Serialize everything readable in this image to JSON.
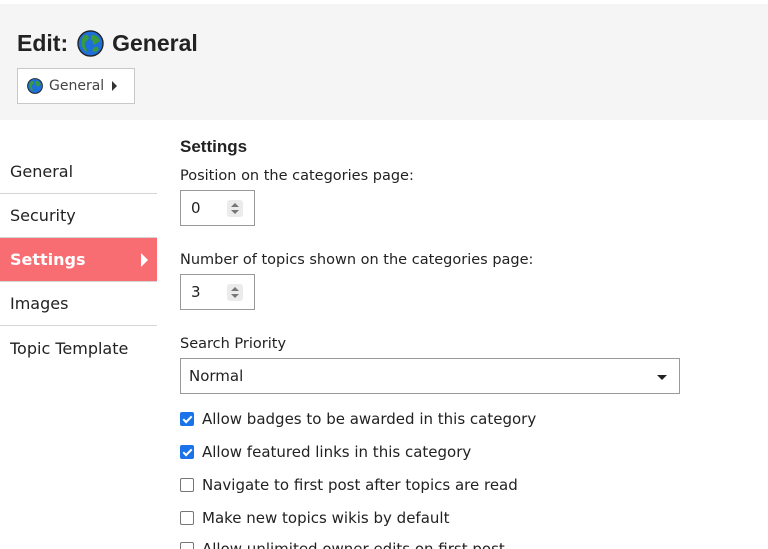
{
  "header": {
    "edit_prefix": "Edit:",
    "category_name": "General",
    "breadcrumb": {
      "label": "General"
    }
  },
  "colors": {
    "header_bg": "#f5f5f5",
    "active_nav_bg": "#f86d72",
    "checkbox_checked": "#1a73e8",
    "globe_ocean": "#1e6fd9",
    "globe_land": "#3a9b3a"
  },
  "nav": {
    "items": [
      {
        "label": "General",
        "active": false
      },
      {
        "label": "Security",
        "active": false
      },
      {
        "label": "Settings",
        "active": true
      },
      {
        "label": "Images",
        "active": false
      },
      {
        "label": "Topic Template",
        "active": false
      }
    ]
  },
  "settings": {
    "title": "Settings",
    "position": {
      "label": "Position on the categories page:",
      "value": "0"
    },
    "num_topics": {
      "label": "Number of topics shown on the categories page:",
      "value": "3"
    },
    "search_priority": {
      "label": "Search Priority",
      "selected": "Normal"
    },
    "checkboxes": [
      {
        "label": "Allow badges to be awarded in this category",
        "checked": true
      },
      {
        "label": "Allow featured links in this category",
        "checked": true
      },
      {
        "label": "Navigate to first post after topics are read",
        "checked": false
      },
      {
        "label": "Make new topics wikis by default",
        "checked": false
      },
      {
        "label": "Allow unlimited owner edits on first post",
        "checked": false
      }
    ]
  }
}
